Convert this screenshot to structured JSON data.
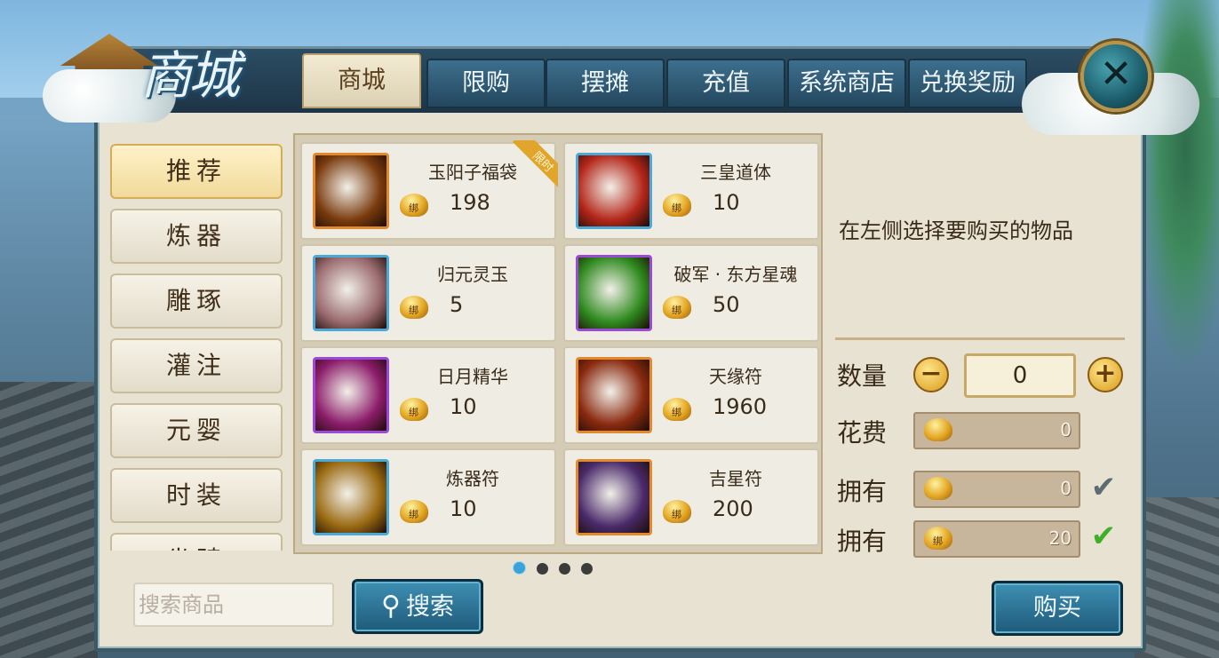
{
  "header": {
    "title": "商城",
    "close_icon": "close-icon"
  },
  "tabs": [
    {
      "label": "商城",
      "active": true
    },
    {
      "label": "限购"
    },
    {
      "label": "摆摊"
    },
    {
      "label": "充值"
    },
    {
      "label": "系统商店"
    },
    {
      "label": "兑换奖励"
    }
  ],
  "categories": [
    {
      "label": "推荐",
      "active": true
    },
    {
      "label": "炼器"
    },
    {
      "label": "雕琢"
    },
    {
      "label": "灌注"
    },
    {
      "label": "元婴"
    },
    {
      "label": "时装"
    },
    {
      "label": "坐骑"
    }
  ],
  "items": [
    {
      "name": "玉阳子福袋",
      "price": "198",
      "badge": "限时",
      "coin_mark": "绑",
      "icon": "lucky-bag-icon",
      "color": "#7a3b0e",
      "border": "#e08a2c"
    },
    {
      "name": "三皇道体",
      "price": "10",
      "coin_mark": "绑",
      "icon": "red-swirl-icon",
      "color": "#b4261a",
      "border": "#4aa9d6"
    },
    {
      "name": "归元灵玉",
      "price": "5",
      "coin_mark": "绑",
      "icon": "jade-stone-icon",
      "color": "#9a6b6f",
      "border": "#4aa9d6"
    },
    {
      "name": "破军 · 东方星魂",
      "price": "50",
      "coin_mark": "绑",
      "icon": "green-orb-icon",
      "color": "#2f8a1e",
      "border": "#9b4ad6"
    },
    {
      "name": "日月精华",
      "price": "10",
      "coin_mark": "绑",
      "icon": "yin-yang-icon",
      "color": "#8c1d6a",
      "border": "#9b4ad6"
    },
    {
      "name": "天缘符",
      "price": "1960",
      "coin_mark": "绑",
      "icon": "fate-talisman-icon",
      "color": "#8a2a10",
      "border": "#e08a2c"
    },
    {
      "name": "炼器符",
      "price": "10",
      "coin_mark": "绑",
      "icon": "refine-talisman-icon",
      "color": "#9a6a12",
      "border": "#4aa9d6"
    },
    {
      "name": "吉星符",
      "price": "200",
      "coin_mark": "绑",
      "icon": "star-talisman-icon",
      "color": "#4a2a6a",
      "border": "#e08a2c"
    }
  ],
  "pagination": {
    "pages": 4,
    "current": 1
  },
  "detail": {
    "hint": "在左侧选择要购买的物品",
    "quantity_label": "数量",
    "quantity": "0",
    "cost_label": "花费",
    "cost": "0",
    "own_label_1": "拥有",
    "own_1": "0",
    "own_label_2": "拥有",
    "own_2": "20",
    "own_2_coin_mark": "绑",
    "minus_symbol": "−",
    "plus_symbol": "+",
    "check_symbol": "✔"
  },
  "search": {
    "placeholder": "搜索商品",
    "button": "搜索",
    "icon": "search-icon"
  },
  "buy_button": "购买",
  "colors": {
    "accent": "#3e8fb3",
    "gold": "#e3a623",
    "active_check": "#3fae2a",
    "inactive_check": "#5d6b73"
  }
}
